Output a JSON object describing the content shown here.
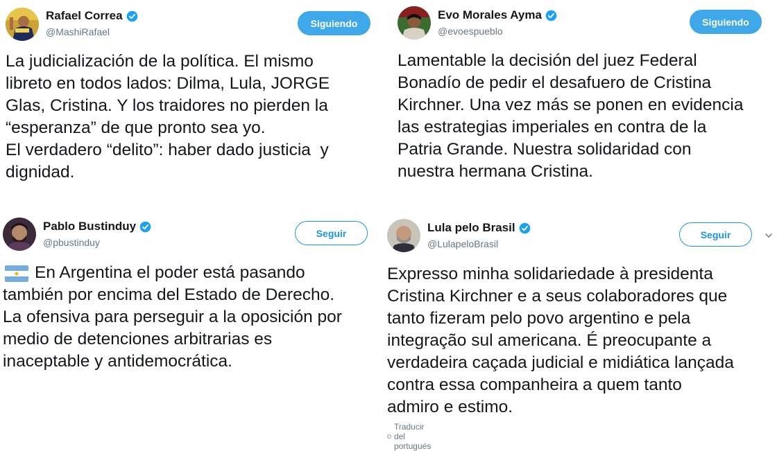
{
  "tweets": [
    {
      "name": "Rafael Correa",
      "handle": "@MashiRafael",
      "button": "Siguiendo",
      "text": "La judicialización de la política. El mismo\nlibreto en todos lados: Dilma, Lula, JORGE\nGlas, Cristina. Y los traidores no pierden la\n“esperanza” de que pronto sea yo.\nEl verdadero “delito”: haber dado justicia  y\ndignidad."
    },
    {
      "name": "Evo Morales Ayma",
      "handle": "@evoespueblo",
      "button": "Siguiendo",
      "text": "Lamentable la decisión del juez Federal\nBonadío de pedir el desafuero de Cristina\nKirchner. Una vez más se ponen en evidencia\nlas estrategias imperiales en contra de la\nPatria Grande. Nuestra solidaridad con\nnuestra hermana Cristina."
    },
    {
      "name": "Pablo Bustinduy",
      "handle": "@pbustinduy",
      "button": "Seguir",
      "text": "En Argentina el poder está pasando\ntambién por encima del Estado de Derecho.\nLa ofensiva para perseguir a la oposición por\nmedio de detenciones arbitrarias es\ninaceptable y antidemocrática."
    },
    {
      "name": "Lula pelo Brasil",
      "handle": "@LulapeloBrasil",
      "button": "Seguir",
      "text": "Expresso minha solidariedade à presidenta\nCristina Kirchner e a seus colaboradores que\ntanto fizeram pelo povo argentino e pela\nintegração sul americana. É preocupante a\nverdadeira caçada judicial e midiática lançada\ncontra essa companheira a quem tanto\nadmiro e estimo.",
      "translate": "Traducir del portugués"
    }
  ],
  "icons": {
    "verified": "verified-badge-icon",
    "flag": "argentina-flag-emoji",
    "globe": "globe-icon",
    "caret": "chevron-down-icon"
  },
  "colors": {
    "verified": "#1da1f2",
    "following_bg": "#3fa8e8",
    "follow_border": "#1b95e0",
    "secondary_text": "#657786"
  }
}
